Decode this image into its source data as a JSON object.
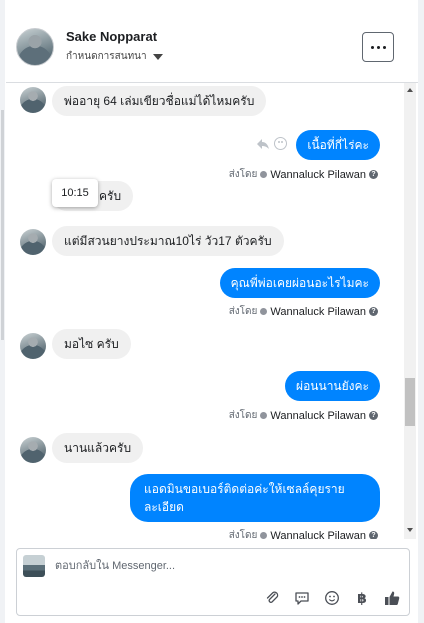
{
  "header": {
    "name": "Sake Nopparat",
    "subtitle": "กำหนดการสนทนา",
    "more_label": "···"
  },
  "tooltip": "10:15",
  "messages": [
    {
      "dir": "in",
      "text": "พ่ออายุ 64 เล่มเขียวชื่อแม่ได้ไหมครับ"
    },
    {
      "dir": "out",
      "text": "เนื้อที่กี่ไร่คะ"
    },
    {
      "dir": "in",
      "text": "จครับ"
    },
    {
      "dir": "in",
      "text": "แต่มีสวนยางประมาณ10ไร่ วัว17 ตัวครับ"
    },
    {
      "dir": "out",
      "text": "คุณพี่พ่อเคยผ่อนอะไรไมคะ"
    },
    {
      "dir": "in",
      "text": "มอไซ ครับ"
    },
    {
      "dir": "out",
      "text": "ผ่อนนานยังคะ"
    },
    {
      "dir": "in",
      "text": "นานแล้วครับ"
    },
    {
      "dir": "out",
      "text": "แอดมินขอเบอร์ติดต่อค่ะให้เซลล์คุยรายละเอียด"
    }
  ],
  "sent_by": {
    "prefix": "ส่งโดย",
    "name": "Wannaluck Pilawan",
    "help": "?"
  },
  "composer": {
    "placeholder": "ตอบกลับใน Messenger..."
  },
  "icons": [
    "attach-icon",
    "chat-icon",
    "emoji-icon",
    "baht-icon",
    "like-icon"
  ],
  "colors": {
    "outgoing": "#0084ff",
    "incoming": "#f0f0f0",
    "border": "#dadde1"
  }
}
